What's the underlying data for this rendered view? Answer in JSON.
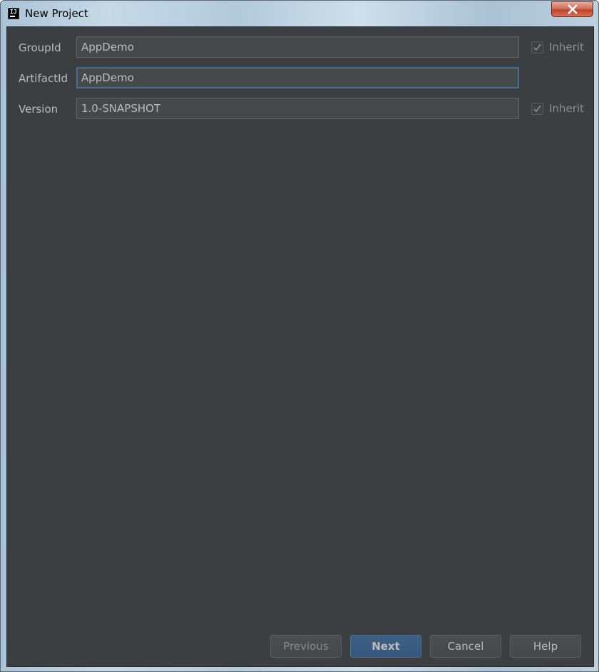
{
  "window": {
    "title": "New Project",
    "close_icon": "close-x-icon",
    "app_icon": "intellij-idea-icon"
  },
  "form": {
    "rows": [
      {
        "label": "GroupId",
        "value": "AppDemo",
        "inherit_label": "Inherit",
        "inherit_checked": true
      },
      {
        "label": "ArtifactId",
        "value": "AppDemo",
        "focused": true
      },
      {
        "label": "Version",
        "value": "1.0-SNAPSHOT",
        "inherit_label": "Inherit",
        "inherit_checked": true
      }
    ]
  },
  "buttons": {
    "previous": "Previous",
    "next": "Next",
    "cancel": "Cancel",
    "help": "Help"
  },
  "colors": {
    "background": "#3c3f41",
    "field_background": "#45494a",
    "focus_border": "#466d94",
    "primary_button": "#365880",
    "text": "#bbbbbb"
  }
}
